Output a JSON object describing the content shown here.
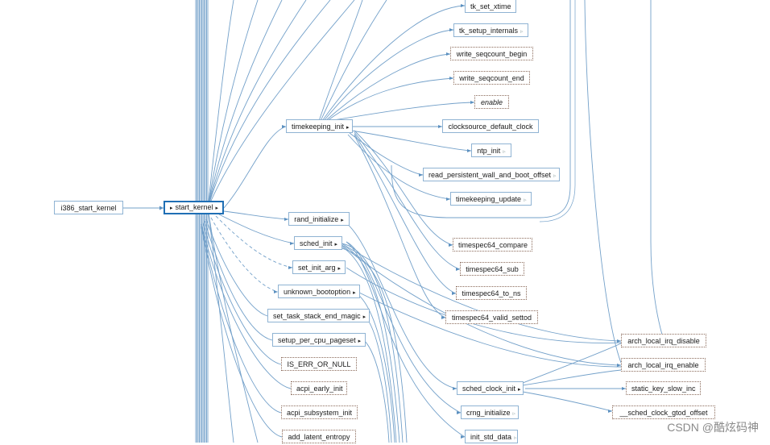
{
  "nodes": {
    "tk_set_xtime": "tk_set_xtime",
    "tk_setup_internals": "tk_setup_internals",
    "write_seqcount_begin": "write_seqcount_begin",
    "write_seqcount_end": "write_seqcount_end",
    "enable": "enable",
    "timekeeping_init": "timekeeping_init",
    "clocksource_default_clock": "clocksource_default_clock",
    "ntp_init": "ntp_init",
    "read_persistent_wall_and_boot_offset": "read_persistent_wall_and_boot_offset",
    "timekeeping_update": "timekeeping_update",
    "i386_start_kernel": "i386_start_kernel",
    "start_kernel": "start_kernel",
    "rand_initialize": "rand_initialize",
    "sched_init": "sched_init",
    "set_init_arg": "set_init_arg",
    "unknown_bootoption": "unknown_bootoption",
    "set_task_stack_end_magic": "set_task_stack_end_magic",
    "setup_per_cpu_pageset": "setup_per_cpu_pageset",
    "is_err_or_null": "IS_ERR_OR_NULL",
    "acpi_early_init": "acpi_early_init",
    "acpi_subsystem_init": "acpi_subsystem_init",
    "add_latent_entropy": "add_latent_entropy",
    "timespec64_compare": "timespec64_compare",
    "timespec64_sub": "timespec64_sub",
    "timespec64_to_ns": "timespec64_to_ns",
    "timespec64_valid_settod": "timespec64_valid_settod",
    "arch_local_irq_disable": "arch_local_irq_disable",
    "arch_local_irq_enable": "arch_local_irq_enable",
    "sched_clock_init": "sched_clock_init",
    "static_key_slow_inc": "static_key_slow_inc",
    "crng_initialize": "crng_initialize",
    "sched_clock_gtod_offset": "__sched_clock_gtod_offset",
    "init_std_data": "init_std_data"
  },
  "icons": {
    "expand": "▸",
    "collapse": "◂",
    "expand_light": "▹"
  },
  "colors": {
    "edge": "#5a8fbf",
    "border_solid": "#8fb3d3",
    "border_dotted": "#8a6a5a",
    "selected": "#1f6fb5"
  },
  "watermark": "CSDN @酷炫码神"
}
